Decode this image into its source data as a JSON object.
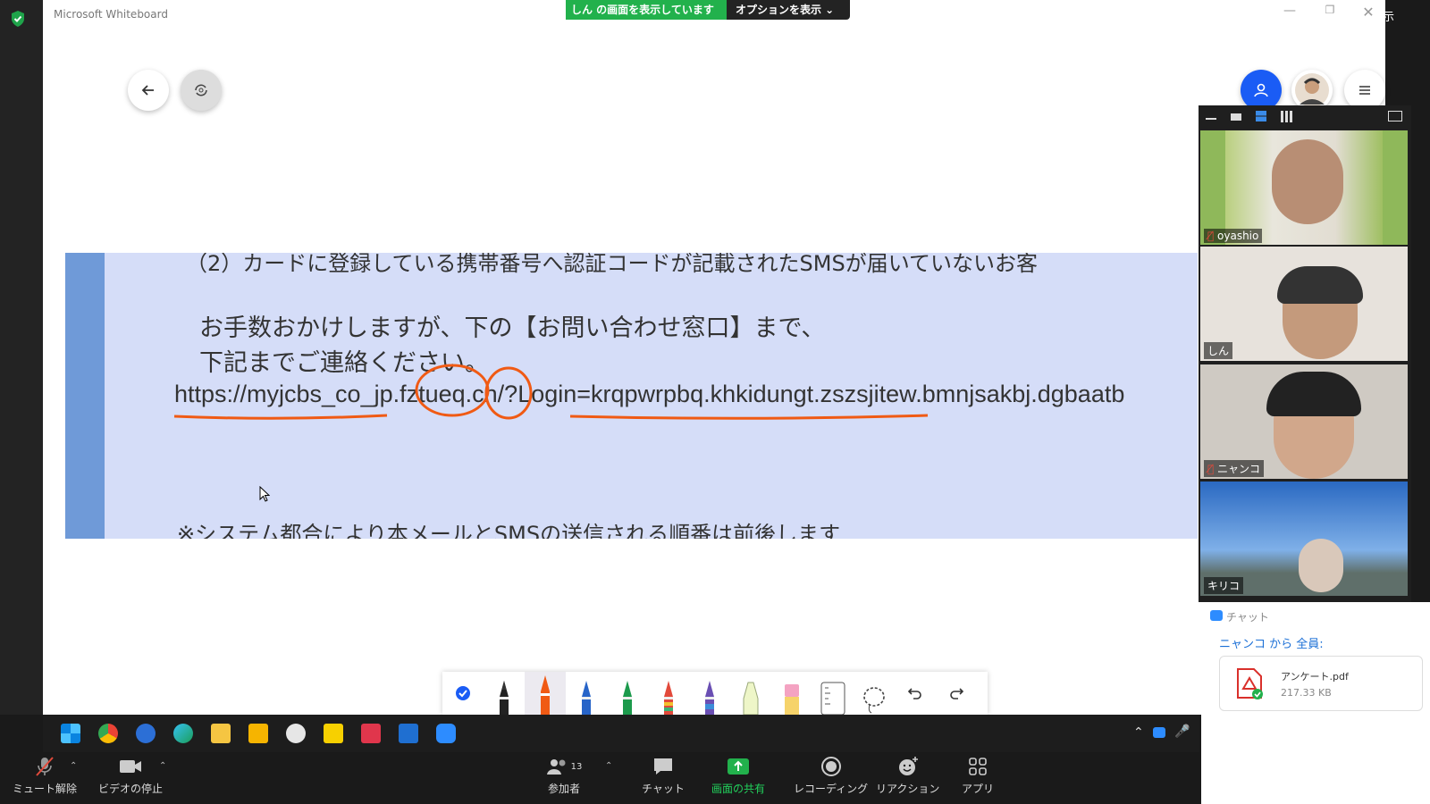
{
  "window": {
    "title": "Microsoft Whiteboard",
    "minimize": "—",
    "maximize": "❐",
    "close": "✕"
  },
  "share_banner": {
    "status": "しん の画面を表示しています",
    "options": "オプションを表示 ⌄",
    "show_button": "表示"
  },
  "slide": {
    "top_line": "（2）カードに登録している携帯番号へ認証コードが記載されたSMSが届いていないお客",
    "line1": "お手数おかけしますが、下の【お問い合わせ窓口】まで、",
    "line2": "下記までご連絡ください。",
    "url": "https://myjcbs_co_jp.fztueq.cn/?Login=krqpwrpbq.khkidungt.zszsjitew.bmnjsakbj.dgbaatb",
    "bottom_line": "※システム都合により本メールとSMSの送信される順番は前後します"
  },
  "ink_color": "#f05a14",
  "gallery": {
    "participants": [
      {
        "name": "oyashio",
        "muted": true
      },
      {
        "name": "しん",
        "muted": false
      },
      {
        "name": "ニャンコ",
        "muted": true
      },
      {
        "name": "キリコ",
        "muted": false
      }
    ]
  },
  "chat": {
    "title": "チャット",
    "from_line": "ニャンコ から 全員:",
    "file_name": "アンケート.pdf",
    "file_size": "217.33 KB"
  },
  "controls": {
    "mute": "ミュート解除",
    "video": "ビデオの停止",
    "participants": "参加者",
    "participant_count": "13",
    "chat": "チャット",
    "share": "画面の共有",
    "record": "レコーディング",
    "reactions": "リアクション",
    "apps": "アプリ"
  },
  "colors": {
    "accent_blue": "#1a5cf5",
    "share_green": "#22b14c",
    "slide_bg": "#d5ddf8",
    "slide_bar": "#6f9ad8"
  }
}
